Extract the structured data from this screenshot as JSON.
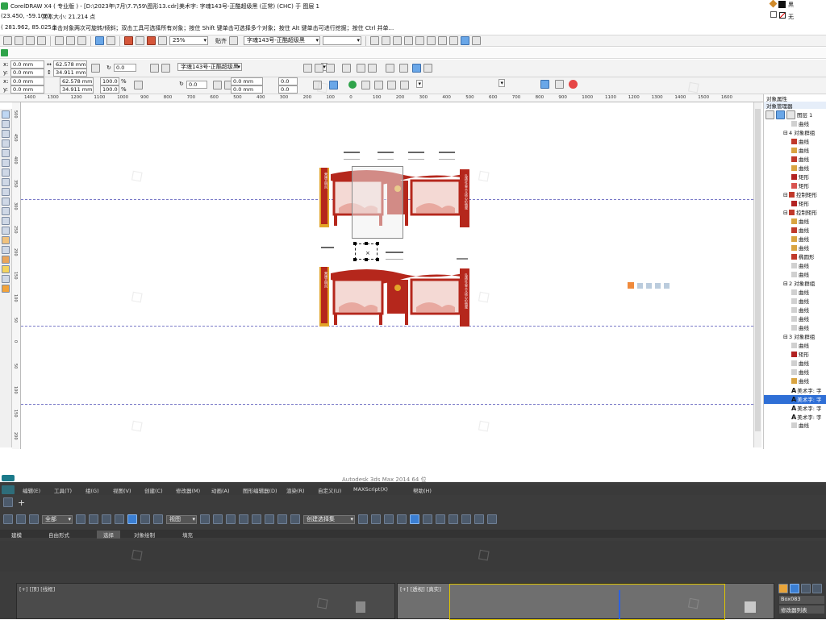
{
  "title": {
    "app": "CorelDRAW X4 ( 专业版 ) - [D:\\2023年\\7月\\7.7\\59\\图形13.cdr]",
    "object_info": "美术字: 字魂143号-正酷超级黑 (正常) (CHC) 于 图层 1",
    "cursor": "(23.450, -59.106)",
    "text_size": "文本大小: 21.214 点",
    "fill_label": "黑",
    "outline_label": "无"
  },
  "status": {
    "coords": "( 281.962, 85.025 )",
    "hint": "单击对象两次可旋转/倾斜；双击工具可选择所有对象；按住 Shift 键单击可选择多个对象；按住 Alt 键单击可进行挖掘；按住 Ctrl 并单..."
  },
  "toolbar": {
    "zoom": "25%",
    "snap": "贴齐",
    "font": "字魂143号-正酷超级黑",
    "font_size": ""
  },
  "propbar1": {
    "x": "0.0 mm",
    "y": "0.0 mm",
    "w": "62.578 mm",
    "h": "34.911 mm",
    "angle": "0.0",
    "font": "字魂143号-正酷超级黑",
    "size": ""
  },
  "propbar2": {
    "x": "0.0 mm",
    "y": "0.0 mm",
    "w": "62.578 mm",
    "h": "34.911 mm",
    "sx": "100.0",
    "sy": "100.0",
    "pct": "%",
    "angle": "0.0",
    "p1": "0.0 mm",
    "p2": "0.0 mm",
    "v1": "0.0",
    "v2": "0.0"
  },
  "ruler": {
    "h_ticks": [
      "1400",
      "1300",
      "1200",
      "1100",
      "1000",
      "900",
      "800",
      "700",
      "600",
      "500",
      "400",
      "300",
      "200",
      "100",
      "0",
      "100",
      "200",
      "300",
      "400",
      "500",
      "600",
      "700",
      "800",
      "900",
      "1000",
      "1100",
      "1200",
      "1300",
      "1400",
      "1500",
      "1600"
    ],
    "v_ticks": [
      "500",
      "450",
      "400",
      "350",
      "300",
      "250",
      "200",
      "150",
      "100",
      "50",
      "0",
      "50",
      "100",
      "150",
      "200",
      "250",
      "300",
      "350",
      "400",
      "450"
    ],
    "unit": "毫米"
  },
  "object_panel": {
    "tab1": "对象属性",
    "tab2": "对象管理器",
    "layer_name": "图层 1",
    "items": [
      {
        "label": "曲线",
        "color": "#d0d0d0",
        "indent": 1
      },
      {
        "label": "4 对象群组",
        "color": "",
        "indent": 0
      },
      {
        "label": "曲线",
        "color": "#c0392b",
        "indent": 1
      },
      {
        "label": "曲线",
        "color": "#d9a441",
        "indent": 1
      },
      {
        "label": "曲线",
        "color": "#c0392b",
        "indent": 1
      },
      {
        "label": "曲线",
        "color": "#d9a441",
        "indent": 1
      },
      {
        "label": "矩形",
        "color": "#b22222",
        "indent": 1
      },
      {
        "label": "矩形",
        "color": "#d9534f",
        "indent": 1
      },
      {
        "label": "控制矩形",
        "color": "#c0392b",
        "indent": 0
      },
      {
        "label": "矩形",
        "color": "#b22222",
        "indent": 1
      },
      {
        "label": "控制矩形",
        "color": "#c0392b",
        "indent": 0
      },
      {
        "label": "曲线",
        "color": "#d9a441",
        "indent": 1
      },
      {
        "label": "曲线",
        "color": "#c0392b",
        "indent": 1
      },
      {
        "label": "曲线",
        "color": "#d9a441",
        "indent": 1
      },
      {
        "label": "曲线",
        "color": "#d9a441",
        "indent": 1
      },
      {
        "label": "椭圆形",
        "color": "#c0392b",
        "indent": 1
      },
      {
        "label": "曲线",
        "color": "#d0d0d0",
        "indent": 1
      },
      {
        "label": "曲线",
        "color": "#d0d0d0",
        "indent": 1
      },
      {
        "label": "2 对象群组",
        "color": "",
        "indent": 0
      },
      {
        "label": "曲线",
        "color": "#d0d0d0",
        "indent": 1
      },
      {
        "label": "曲线",
        "color": "#d0d0d0",
        "indent": 1
      },
      {
        "label": "曲线",
        "color": "#d0d0d0",
        "indent": 1
      },
      {
        "label": "曲线",
        "color": "#d0d0d0",
        "indent": 1
      },
      {
        "label": "曲线",
        "color": "#d0d0d0",
        "indent": 1
      },
      {
        "label": "3 对象群组",
        "color": "",
        "indent": 0
      },
      {
        "label": "曲线",
        "color": "#d0d0d0",
        "indent": 1
      },
      {
        "label": "矩形",
        "color": "#b22222",
        "indent": 1
      },
      {
        "label": "曲线",
        "color": "#d0d0d0",
        "indent": 1
      },
      {
        "label": "曲线",
        "color": "#d0d0d0",
        "indent": 1
      },
      {
        "label": "曲线",
        "color": "#d9a441",
        "indent": 1
      },
      {
        "label": "美术字: 字",
        "color": "",
        "indent": 1,
        "artistic": true
      },
      {
        "label": "美术字: 字",
        "color": "",
        "indent": 1,
        "artistic": true,
        "selected": true
      },
      {
        "label": "美术字: 字",
        "color": "",
        "indent": 1,
        "artistic": true
      },
      {
        "label": "美术字: 字",
        "color": "",
        "indent": 1,
        "artistic": true
      },
      {
        "label": "曲线",
        "color": "#d0d0d0",
        "indent": 1
      }
    ]
  },
  "canvas": {
    "board_top_text_left": "营建文明风",
    "board_top_text_right": "弘扬社会主义核心价值观",
    "board_bottom_text_left": "营建文明风",
    "board_bottom_text_right": "弘扬社会主义核心价值观"
  },
  "max": {
    "title_fragment": "Autodesk 3ds Max  2014  64 位",
    "menu": [
      "编辑(E)",
      "工具(T)",
      "组(G)",
      "视图(V)",
      "创建(C)",
      "修改器(M)",
      "动画(A)",
      "图形编辑器(D)",
      "渲染(R)",
      "自定义(U)",
      "MAXScript(X)",
      "帮助(H)"
    ],
    "select_all": "全部",
    "view_combo": "视图",
    "selection_set": "创建选择集",
    "ribbon_tabs": [
      "建模",
      "自由形式",
      "选择",
      "对象绘制",
      "填充"
    ],
    "viewport_left": "[+] [顶] [线框]",
    "viewport_right": "[+] [透视] [真实]",
    "object_name": "Box083",
    "modifier_list": "修改器列表"
  },
  "colors": {
    "accent_blue": "#1f6fd1",
    "board_red": "#b5271c",
    "board_gold": "#e2a529",
    "max_bg": "#3c3c3c"
  }
}
